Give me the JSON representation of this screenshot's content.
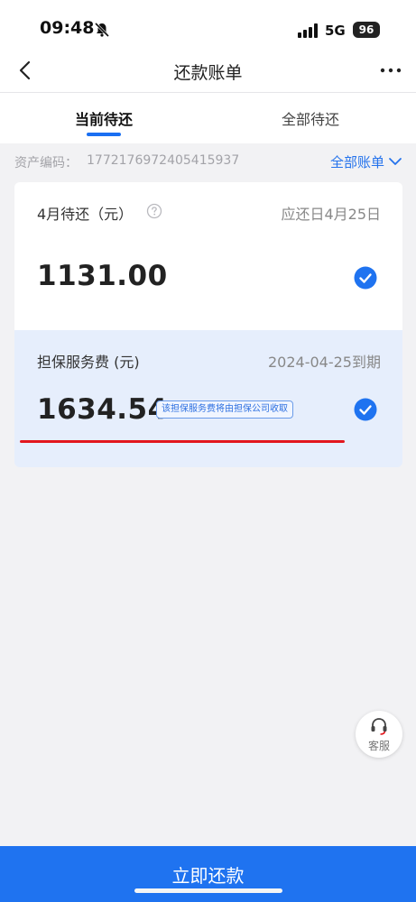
{
  "status_bar": {
    "time": "09:48",
    "network": "5G",
    "battery": "96"
  },
  "nav": {
    "title": "还款账单"
  },
  "tabs": [
    {
      "label": "当前待还",
      "active": true
    },
    {
      "label": "全部待还",
      "active": false
    }
  ],
  "asset": {
    "label": "资产编码：",
    "code": "1772176972405415937",
    "all_bills": "全部账单"
  },
  "bill": {
    "month_label": "4月待还（元）",
    "due_label": "应还日4月25日",
    "amount": "1131.00",
    "selected": true
  },
  "fee": {
    "label": "担保服务费 (元)",
    "due_label": "2024-04-25到期",
    "amount": "1634.54",
    "note": "该担保服务费将由担保公司收取",
    "selected": true
  },
  "service": {
    "label": "客服"
  },
  "pay_button": {
    "label": "立即还款"
  },
  "colors": {
    "accent": "#1f73f0",
    "highlight_card": "#e6eefc",
    "annotation_line": "#e2161d"
  }
}
